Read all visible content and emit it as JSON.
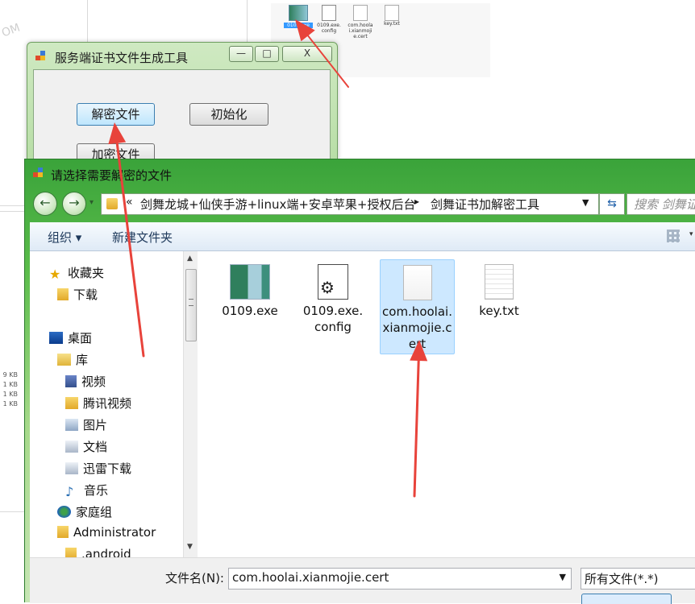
{
  "background": {
    "files": [
      {
        "name": "0109.exe"
      },
      {
        "name": "0109.exe.config"
      },
      {
        "name": "com.hoolai.xianmojie.cert"
      },
      {
        "name": "key.txt"
      }
    ],
    "sizes": [
      "9 KB",
      "1 KB",
      "1 KB",
      "1 KB"
    ]
  },
  "tool_window": {
    "title": "服务端证书文件生成工具",
    "buttons": {
      "decrypt": "解密文件",
      "init": "初始化",
      "encrypt": "加密文件"
    },
    "caption": {
      "min": "—",
      "max": "□",
      "close": "X"
    }
  },
  "dialog": {
    "title": "请选择需要解密的文件",
    "breadcrumb": {
      "prefix": "«",
      "parent": "剑舞龙城+仙侠手游+linux端+安卓苹果+授权后台",
      "separator": "▸",
      "current": "剑舞证书加解密工具"
    },
    "search_placeholder": "搜索 剑舞证书加解密工具",
    "toolbar": {
      "organize": "组织 ▾",
      "new_folder": "新建文件夹"
    },
    "tree": {
      "favorites": "收藏夹",
      "downloads": "下载",
      "desktop": "桌面",
      "library": "库",
      "video": "视频",
      "tencent_video": "腾讯视频",
      "pictures": "图片",
      "documents": "文档",
      "xunlei": "迅雷下载",
      "music": "音乐",
      "homegroup": "家庭组",
      "administrator": "Administrator",
      "android": ".android"
    },
    "files": [
      {
        "name": "0109.exe"
      },
      {
        "name": "0109.exe.config"
      },
      {
        "name": "com.hoolai.xianmojie.cert",
        "selected": true
      },
      {
        "name": "key.txt"
      }
    ],
    "filename_label": "文件名(N):",
    "filename_value": "com.hoolai.xianmojie.cert",
    "filter_value": "所有文件(*.*)"
  },
  "colors": {
    "arrow": "#e8433b",
    "selection": "#cde8ff",
    "aero_green": "#5bbd4b"
  }
}
